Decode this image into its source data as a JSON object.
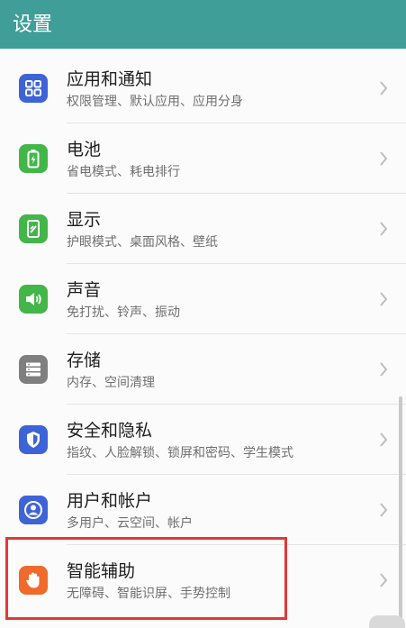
{
  "header": {
    "title": "设置"
  },
  "items": [
    {
      "title": "应用和通知",
      "subtitle": "权限管理、默认应用、应用分身",
      "icon": "apps-grid-icon",
      "color": "#3d63d6"
    },
    {
      "title": "电池",
      "subtitle": "省电模式、耗电排行",
      "icon": "battery-icon",
      "color": "#43b649"
    },
    {
      "title": "显示",
      "subtitle": "护眼模式、桌面风格、壁纸",
      "icon": "display-icon",
      "color": "#43b649"
    },
    {
      "title": "声音",
      "subtitle": "免打扰、铃声、振动",
      "icon": "speaker-icon",
      "color": "#43b649"
    },
    {
      "title": "存储",
      "subtitle": "内存、空间清理",
      "icon": "storage-icon",
      "color": "#7f7f7f"
    },
    {
      "title": "安全和隐私",
      "subtitle": "指纹、人脸解锁、锁屏和密码、学生模式",
      "icon": "shield-icon",
      "color": "#3d63d6"
    },
    {
      "title": "用户和帐户",
      "subtitle": "多用户、云空间、帐户",
      "icon": "user-icon",
      "color": "#3d63d6"
    },
    {
      "title": "智能辅助",
      "subtitle": "无障碍、智能识屏、手势控制",
      "icon": "hand-icon",
      "color": "#ef6a2b"
    }
  ],
  "highlight_color": "#e23838"
}
